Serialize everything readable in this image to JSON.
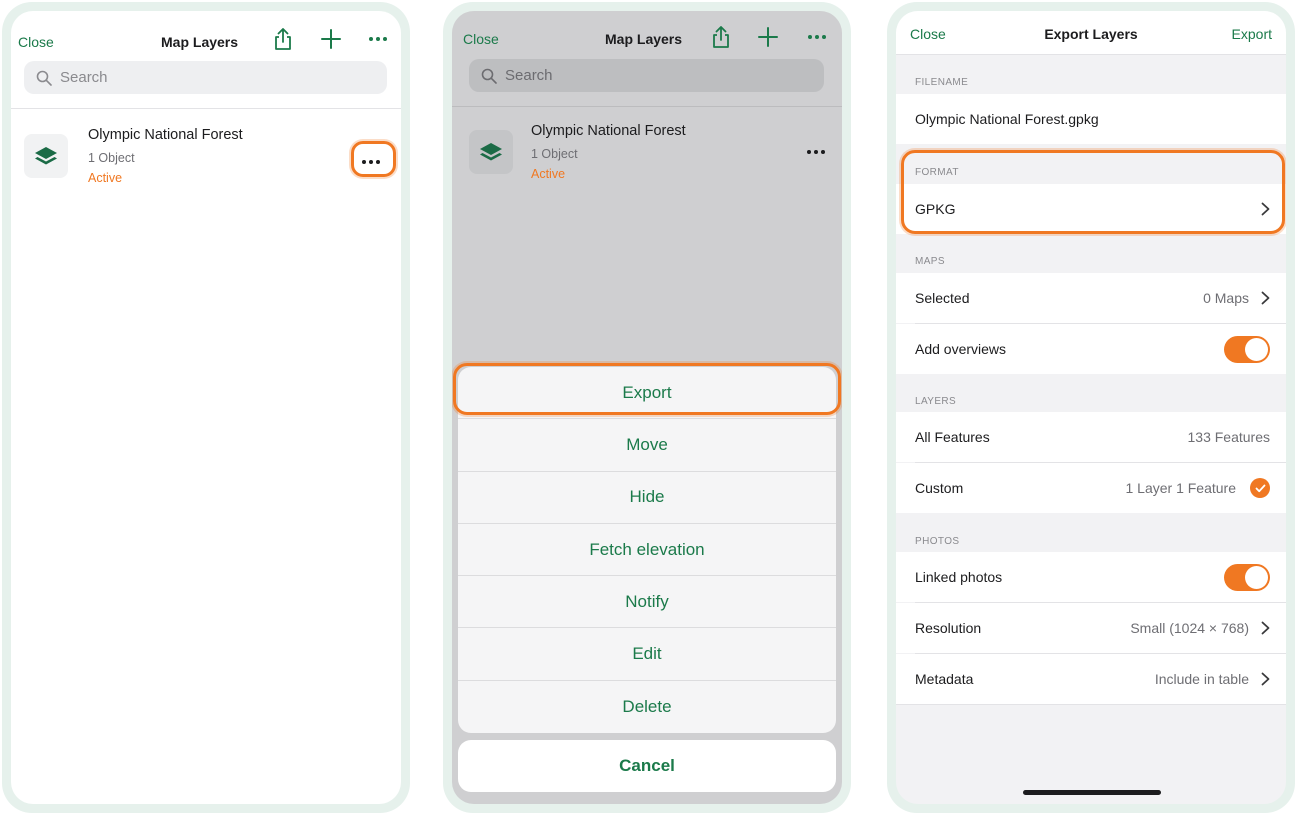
{
  "colors": {
    "accent": "#1b7a4a",
    "highlight": "#f07822"
  },
  "screen1": {
    "close_label": "Close",
    "title": "Map Layers",
    "search_placeholder": "Search",
    "layer": {
      "name": "Olympic National Forest",
      "count": "1 Object",
      "status": "Active"
    }
  },
  "screen2": {
    "close_label": "Close",
    "title": "Map Layers",
    "search_placeholder": "Search",
    "layer": {
      "name": "Olympic National Forest",
      "count": "1 Object",
      "status": "Active"
    },
    "actions": [
      "Export",
      "Move",
      "Hide",
      "Fetch elevation",
      "Notify",
      "Edit",
      "Delete"
    ],
    "cancel_label": "Cancel"
  },
  "screen3": {
    "close_label": "Close",
    "title": "Export Layers",
    "export_label": "Export",
    "filename": {
      "section": "FILENAME",
      "value": "Olympic National Forest.gpkg"
    },
    "format": {
      "section": "FORMAT",
      "value": "GPKG"
    },
    "maps": {
      "section": "MAPS",
      "selected_label": "Selected",
      "selected_value": "0 Maps",
      "overviews_label": "Add overviews",
      "overviews_on": true
    },
    "layers": {
      "section": "LAYERS",
      "all_label": "All Features",
      "all_value": "133 Features",
      "custom_label": "Custom",
      "custom_value": "1 Layer 1 Feature",
      "custom_checked": true
    },
    "photos": {
      "section": "PHOTOS",
      "linked_label": "Linked photos",
      "linked_on": true,
      "resolution_label": "Resolution",
      "resolution_value": "Small (1024 × 768)",
      "metadata_label": "Metadata",
      "metadata_value": "Include in table"
    }
  }
}
